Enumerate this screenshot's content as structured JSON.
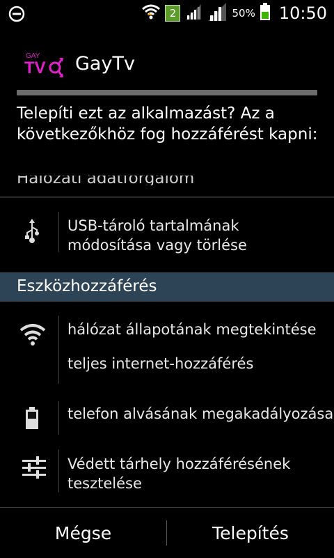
{
  "status_bar": {
    "notification_count": "2",
    "battery_percent": "50%",
    "time": "10:50"
  },
  "app": {
    "icon_top": "GAY",
    "icon_main": "TV",
    "name": "GayTv"
  },
  "question": "Telepíti ezt az alkalmazást? Az a következőkhöz fog hozzáférést kapni:",
  "partial_section_header": "Hálózati adatforgalom",
  "permissions_before": [
    {
      "icon": "usb-icon",
      "lines": [
        "USB-tároló tartalmának",
        "módosítása vagy törlése"
      ]
    }
  ],
  "section_device": "Eszközhozzáférés",
  "device_permissions": [
    {
      "icon": "wifi-icon",
      "items": [
        "hálózat állapotának megtekintése",
        "teljes internet-hozzáférés"
      ]
    },
    {
      "icon": "battery-icon",
      "items": [
        "telefon alvásának megakadályozása"
      ]
    },
    {
      "icon": "sliders-icon",
      "items": [
        "Védett tárhely hozzáférésének",
        "tesztelése"
      ]
    }
  ],
  "buttons": {
    "cancel": "Mégse",
    "install": "Telepítés"
  },
  "colors": {
    "section_bg": "#2d4356",
    "accent_magenta": "#e020c8"
  }
}
